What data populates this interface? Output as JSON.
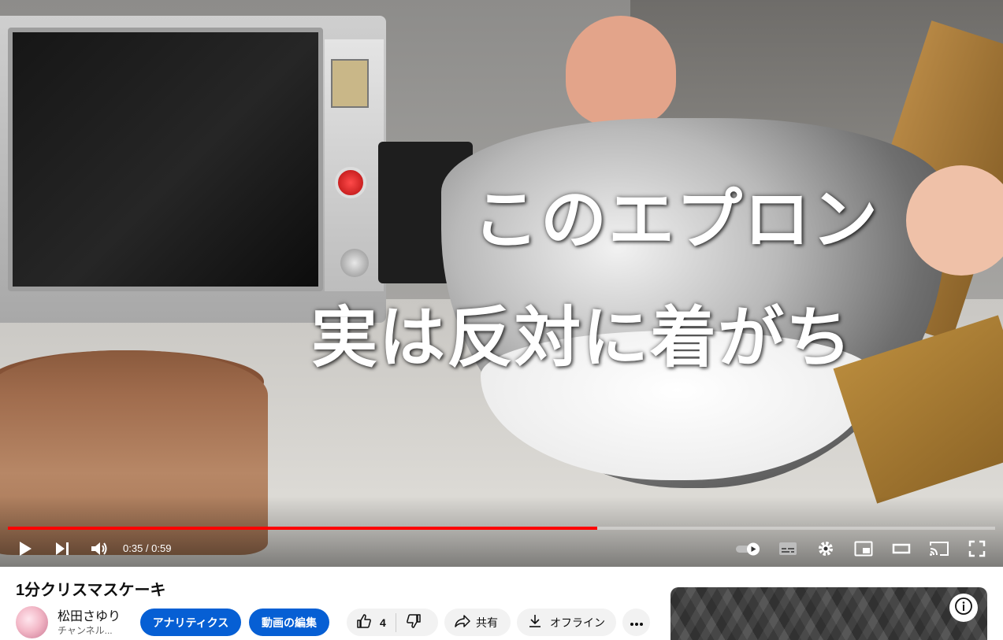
{
  "video": {
    "caption_line1": "このエプロン",
    "caption_line2": "実は反対に着がち",
    "progress_fraction": 0.597,
    "time_display": "0:35 / 0:59"
  },
  "player_controls": {
    "play_icon": "play-icon",
    "next_icon": "next-icon",
    "volume_icon": "volume-icon",
    "autoplay_icon": "autoplay-toggle-icon",
    "subtitles_icon": "subtitles-icon",
    "settings_icon": "gear-icon",
    "miniplayer_icon": "miniplayer-icon",
    "theater_icon": "theater-mode-icon",
    "cast_icon": "cast-icon",
    "fullscreen_icon": "fullscreen-icon"
  },
  "meta": {
    "title": "1分クリスマスケーキ",
    "channel_name": "松田さゆり",
    "channel_sub": "チャンネル..."
  },
  "actions": {
    "analytics_label": "アナリティクス",
    "edit_label": "動画の編集",
    "like_count": "4",
    "share_label": "共有",
    "offline_label": "オフライン"
  },
  "colors": {
    "progress": "#ff0000",
    "primary_button": "#065fd4"
  }
}
